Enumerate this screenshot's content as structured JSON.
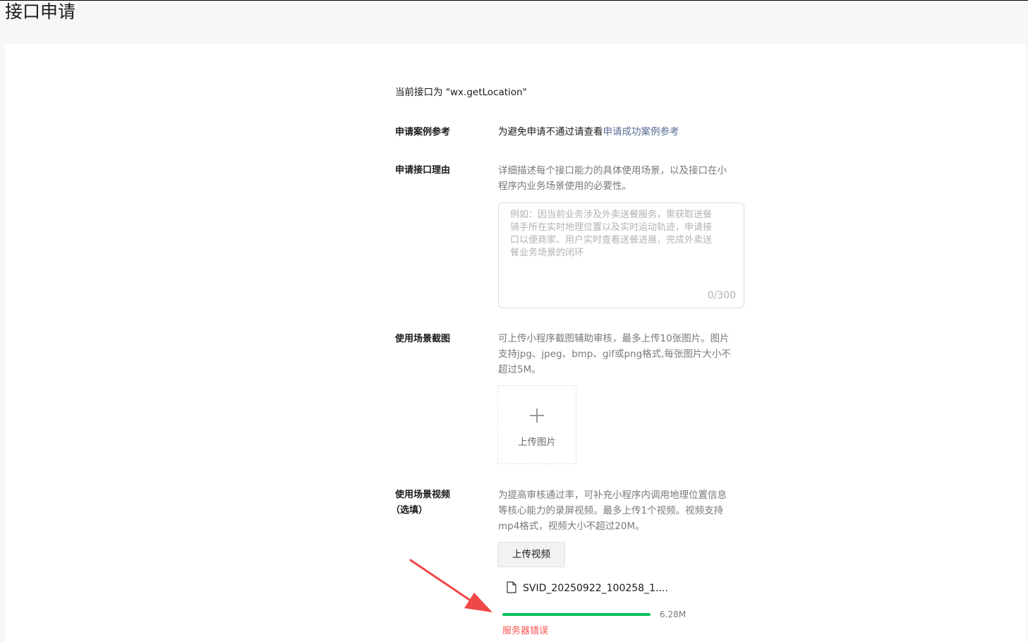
{
  "page": {
    "title": "接口申请"
  },
  "intro": {
    "current_api": "当前接口为 \"wx.getLocation\""
  },
  "case_ref": {
    "label": "申请案例参考",
    "text": "为避免申请不通过请查看",
    "link": "申请成功案例参考"
  },
  "reason": {
    "label": "申请接口理由",
    "desc_line1": "详细描述每个接口能力的具体使用场景，以及接口在小",
    "desc_line2": "程序内业务场景使用的必要性。",
    "placeholder_lines": [
      "例如：因当前业务涉及外卖送餐服务，需获取送餐",
      "骑手所在实时地理位置以及实时运动轨迹，申请接",
      "口以便商家、用户实时查看送餐进展，完成外卖送",
      "餐业务场景的闭环"
    ],
    "counter": "0/300"
  },
  "screenshots": {
    "label": "使用场景截图",
    "desc_line1": "可上传小程序截图辅助审核，最多上传10张图片。图片",
    "desc_line2": "支持jpg、jpeg、bmp、gif或png格式,每张图片大小不",
    "desc_line3": "超过5M。",
    "upload_label": "上传图片",
    "upload_icon": "plus-icon"
  },
  "video": {
    "label_line1": "使用场景视频",
    "label_line2": "（选填）",
    "desc_line1": "为提高审核通过率，可补充小程序内调用地理位置信息",
    "desc_line2": "等核心能力的录屏视频。最多上传1个视频。视频支持",
    "desc_line3": "mp4格式，视频大小不超过20M。",
    "upload_button": "上传视频",
    "file_icon": "file-icon",
    "file_name": "SVID_20250922_100258_1....",
    "file_size": "6.28M",
    "progress": 1.0,
    "error": "服务器错误"
  },
  "colors": {
    "link": "#576b95",
    "progress": "#07c160",
    "error": "#fa5151",
    "arrow": "#f04848"
  }
}
